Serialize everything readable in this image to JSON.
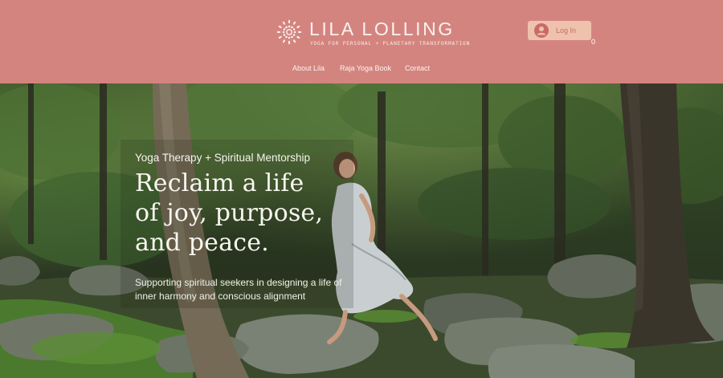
{
  "colors": {
    "header_bg": "#d4847f",
    "login_bg": "#eec2ad",
    "login_text": "#c96a6a",
    "header_text": "#fbf1ef"
  },
  "brand": {
    "name": "LILA LOLLING",
    "tagline": "YOGA FOR PERSONAL + PLANETARY TRANSFORMATION",
    "logo_icon": "sun-mandala-icon"
  },
  "account": {
    "login_label": "Log In",
    "avatar_icon": "user-avatar-icon",
    "cart_count": "0"
  },
  "nav": {
    "items": [
      {
        "label": "About Lila"
      },
      {
        "label": "Raja Yoga Book"
      },
      {
        "label": "Contact"
      }
    ]
  },
  "hero": {
    "eyebrow": "Yoga Therapy + Spiritual Mentorship",
    "headline": "Reclaim a life\nof joy, purpose,\nand peace.",
    "subline": "Supporting spiritual seekers in designing a life of inner harmony and conscious alignment",
    "image": "woman-running-in-forest-photo"
  }
}
